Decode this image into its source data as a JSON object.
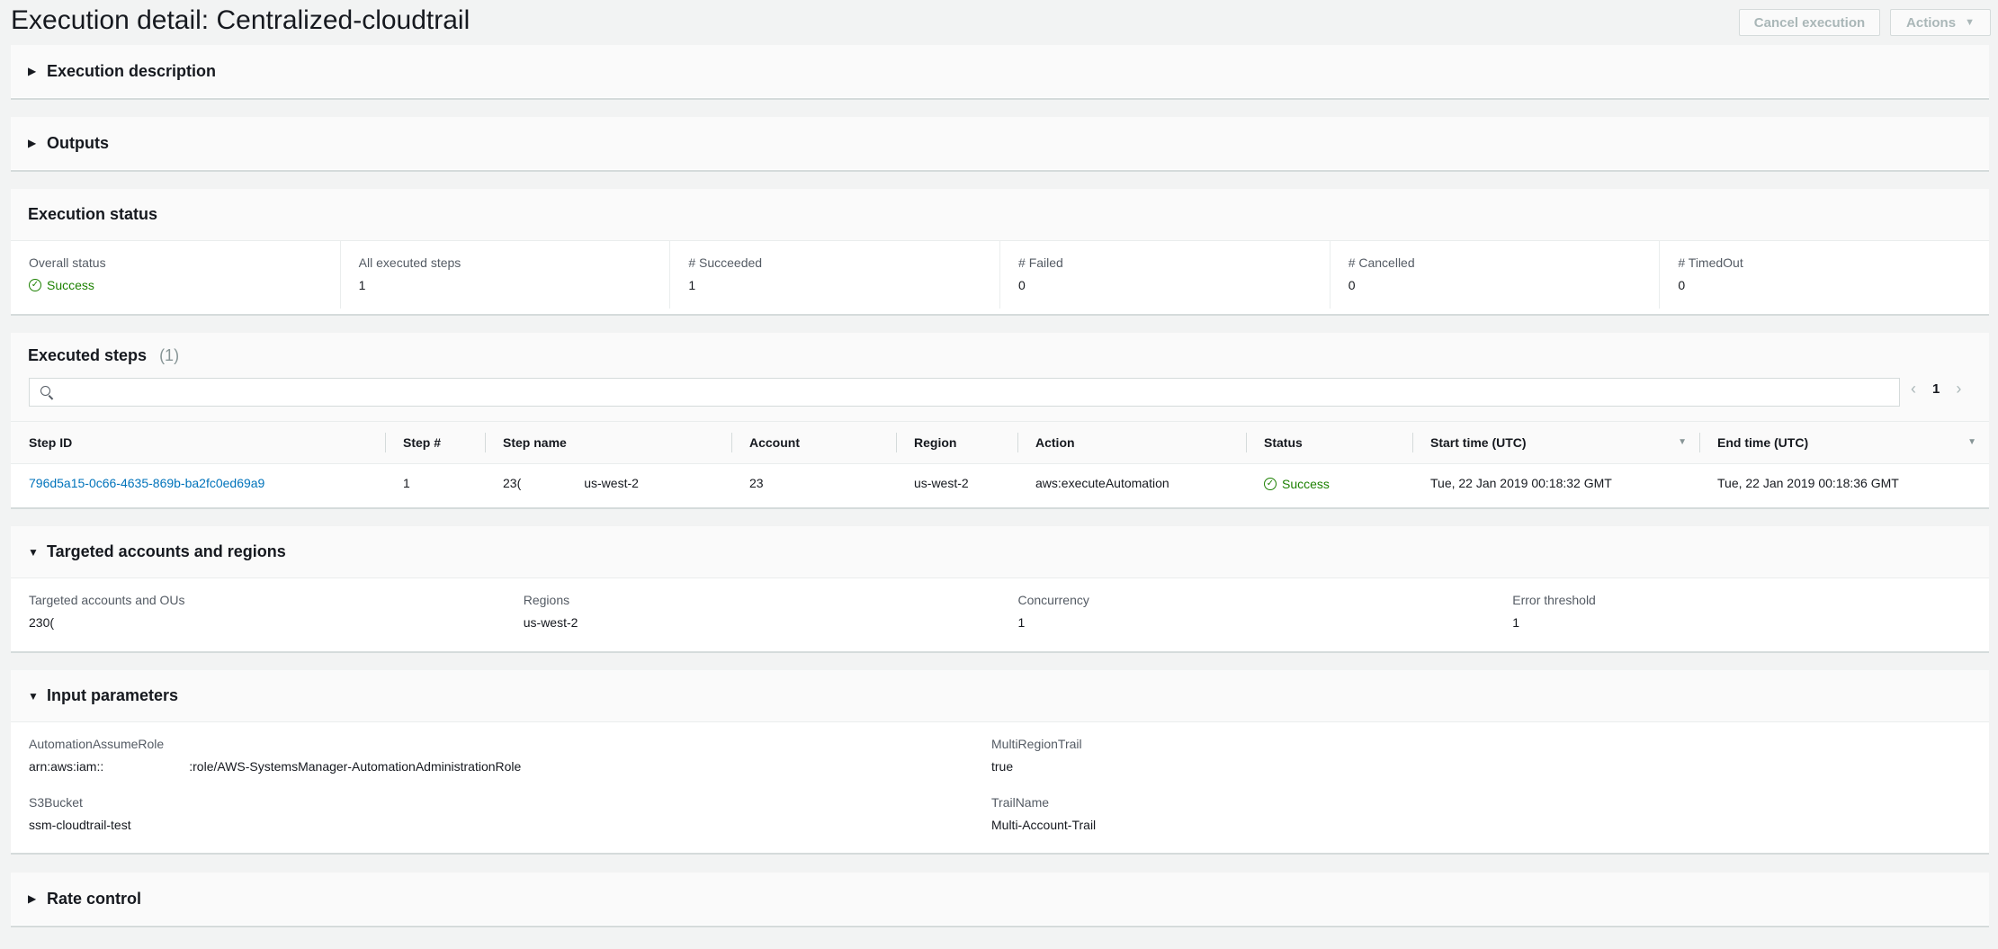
{
  "header": {
    "title": "Execution detail: Centralized-cloudtrail",
    "cancel_label": "Cancel execution",
    "actions_label": "Actions"
  },
  "sections": {
    "execution_description": "Execution description",
    "outputs": "Outputs",
    "execution_status": "Execution status",
    "executed_steps": "Executed steps",
    "executed_steps_count": "(1)",
    "targeted": "Targeted accounts and regions",
    "input_parameters": "Input parameters",
    "rate_control": "Rate control"
  },
  "status": {
    "overall_label": "Overall status",
    "overall_value": "Success",
    "all_label": "All executed steps",
    "all_value": "1",
    "succeeded_label": "# Succeeded",
    "succeeded_value": "1",
    "failed_label": "# Failed",
    "failed_value": "0",
    "cancelled_label": "# Cancelled",
    "cancelled_value": "0",
    "timedout_label": "# TimedOut",
    "timedout_value": "0"
  },
  "steps": {
    "search_placeholder": "",
    "page": "1",
    "columns": {
      "step_id": "Step ID",
      "step_num": "Step #",
      "step_name": "Step name",
      "account": "Account",
      "region": "Region",
      "action": "Action",
      "status": "Status",
      "start_time": "Start time (UTC)",
      "end_time": "End time (UTC)"
    },
    "rows": [
      {
        "step_id": "796d5a15-0c66-4635-869b-ba2fc0ed69a9",
        "step_num": "1",
        "step_name_prefix": "23(",
        "step_name_suffix": "us-west-2",
        "account": "23",
        "region": "us-west-2",
        "action": "aws:executeAutomation",
        "status": "Success",
        "start_time": "Tue, 22 Jan 2019 00:18:32 GMT",
        "end_time": "Tue, 22 Jan 2019 00:18:36 GMT"
      }
    ]
  },
  "targets": {
    "accounts_label": "Targeted accounts and OUs",
    "accounts_value": "230(",
    "regions_label": "Regions",
    "regions_value": "us-west-2",
    "concurrency_label": "Concurrency",
    "concurrency_value": "1",
    "error_threshold_label": "Error threshold",
    "error_threshold_value": "1"
  },
  "inputs": {
    "role_label": "AutomationAssumeRole",
    "role_prefix": "arn:aws:iam::",
    "role_suffix": ":role/AWS-SystemsManager-AutomationAdministrationRole",
    "multiregion_label": "MultiRegionTrail",
    "multiregion_value": "true",
    "s3_label": "S3Bucket",
    "s3_value": "ssm-cloudtrail-test",
    "trail_label": "TrailName",
    "trail_value": "Multi-Account-Trail"
  },
  "colors": {
    "success": "#1d8102",
    "link": "#0073bb",
    "background": "#f2f3f3"
  }
}
